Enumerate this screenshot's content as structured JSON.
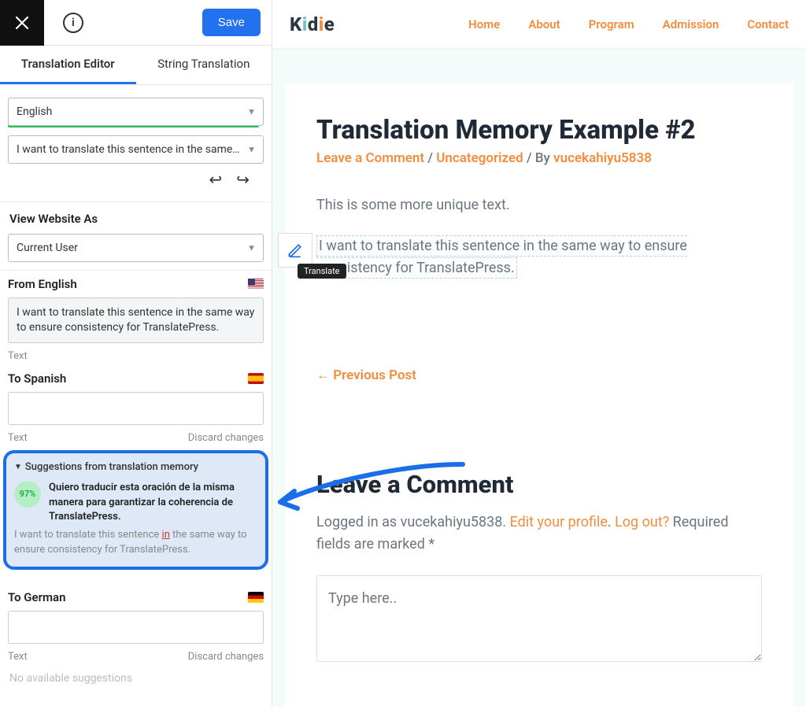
{
  "topbar": {
    "save": "Save"
  },
  "tabs": {
    "editor": "Translation Editor",
    "string": "String Translation"
  },
  "lang_select": "English",
  "string_select": "I want to translate this sentence in the same way t…",
  "view_as": {
    "label": "View Website As",
    "value": "Current User"
  },
  "from": {
    "label": "From English",
    "value": "I want to translate this sentence in the same way to ensure consistency for TranslatePress.",
    "sub": "Text"
  },
  "to_es": {
    "label": "To Spanish",
    "sub": "Text",
    "discard": "Discard changes"
  },
  "memory": {
    "title": "Suggestions from translation memory",
    "pct": "97%",
    "es": "Quiero traducir esta oración de la misma manera para garantizar la coherencia de TranslatePress.",
    "en_pre": "I want to translate this sentence ",
    "en_in": "in",
    "en_post": " the same way to ensure consistency for TranslatePress."
  },
  "to_de": {
    "label": "To German",
    "sub": "Text",
    "discard": "Discard changes",
    "noavail": "No available suggestions"
  },
  "site": {
    "nav": {
      "home": "Home",
      "about": "About",
      "program": "Program",
      "admission": "Admission",
      "contact": "Contact"
    },
    "title": "Translation Memory Example #2",
    "meta": {
      "leave": "Leave a Comment",
      "cat": "Uncategorized",
      "by": " / By ",
      "author": "vucekahiyu5838"
    },
    "p1": "This is some more unique text.",
    "p2": "I want to translate this sentence in the same way to ensure consistency for TranslatePress.",
    "tooltip": "Translate",
    "prev": "← Previous Post",
    "comment": {
      "title": "Leave a Comment",
      "logged": "Logged in as vucekahiyu5838. ",
      "edit": "Edit your profile",
      "dot": ". ",
      "logout": "Log out?",
      "req": " Required fields are marked *",
      "placeholder": "Type here.."
    }
  }
}
